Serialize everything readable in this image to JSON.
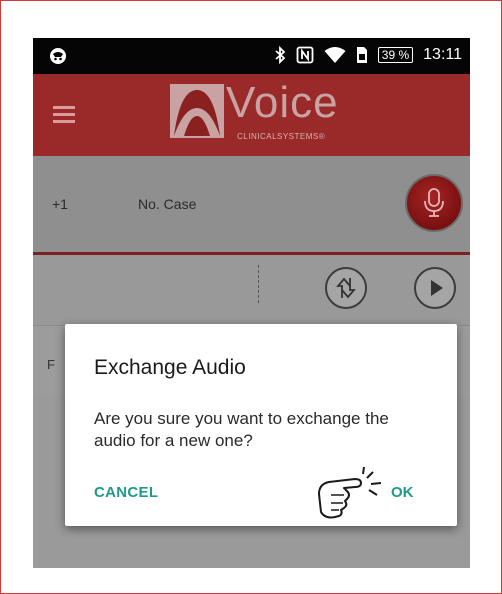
{
  "status_bar": {
    "battery": "39 %",
    "time": "13:11",
    "icons": [
      "app-notification-icon",
      "bluetooth-icon",
      "nfc-icon",
      "wifi-icon",
      "sim-icon"
    ]
  },
  "toolbar": {
    "menu_icon": "hamburger-menu-icon",
    "logo_word": "Voice",
    "logo_sub": "CLINICALSYSTEMS®"
  },
  "case": {
    "prefix": "+1",
    "label": "No. Case",
    "mic_icon": "microphone-icon"
  },
  "controls": {
    "exchange_icon": "exchange-audio-icon",
    "play_icon": "play-icon"
  },
  "lower": {
    "letter": "F"
  },
  "dialog": {
    "title": "Exchange Audio",
    "message": "Are you sure you want to exchange the audio for a new one?",
    "cancel": "CANCEL",
    "ok": "OK"
  },
  "colors": {
    "toolbar": "#9a2a2a",
    "accent": "#1f9a8a",
    "mic": "#a52525"
  }
}
